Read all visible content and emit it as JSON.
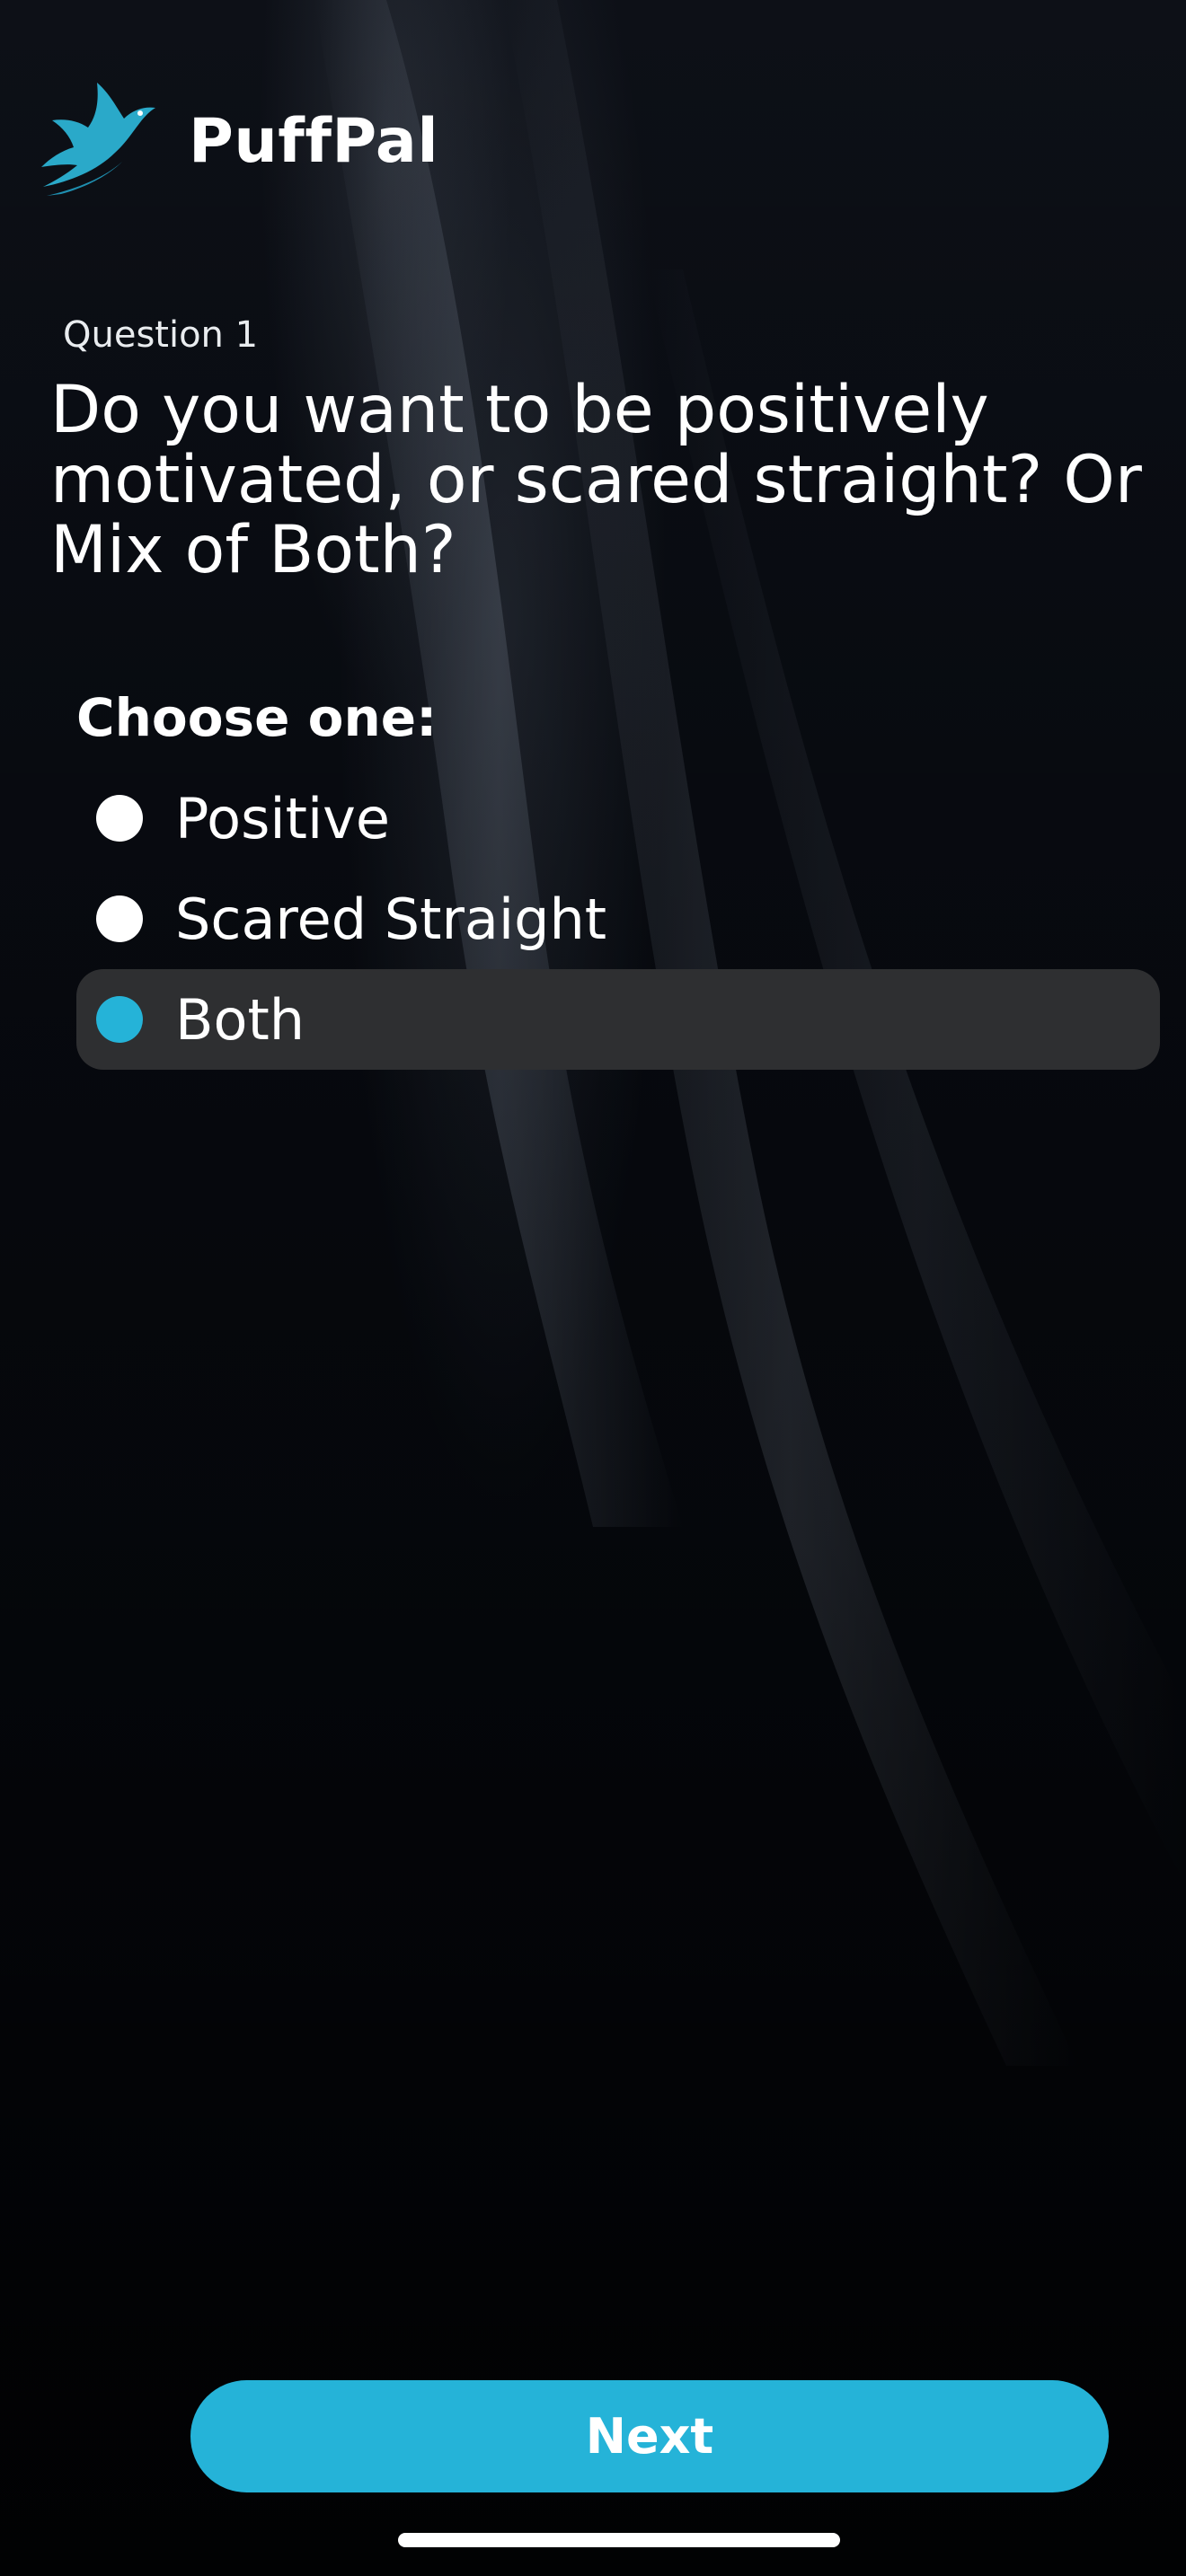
{
  "app": {
    "name": "PuffPal",
    "logo_icon": "bird-logo-icon",
    "accent_color": "#25b3d8"
  },
  "question": {
    "number_label": "Question 1",
    "text": "Do you want to be positively motivated, or scared straight? Or Mix of Both?"
  },
  "choices": {
    "prompt": "Choose one:",
    "options": [
      {
        "label": "Positive",
        "selected": false
      },
      {
        "label": "Scared Straight",
        "selected": false
      },
      {
        "label": "Both",
        "selected": true
      }
    ]
  },
  "actions": {
    "next_label": "Next"
  }
}
